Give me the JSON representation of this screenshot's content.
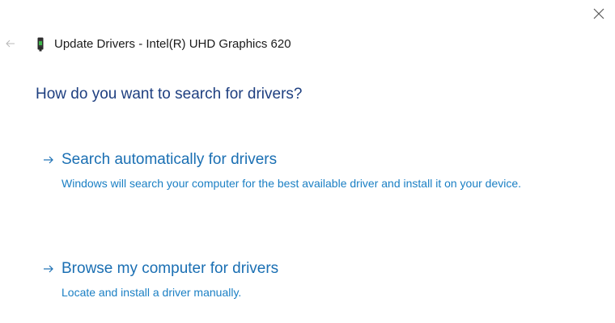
{
  "window": {
    "title": "Update Drivers - Intel(R) UHD Graphics 620",
    "icons": {
      "back": "back-arrow-icon",
      "device": "device-icon",
      "close": "close-icon"
    }
  },
  "main": {
    "heading": "How do you want to search for drivers?",
    "options": [
      {
        "title": "Search automatically for drivers",
        "description": "Windows will search your computer for the best available driver and install it on your device."
      },
      {
        "title": "Browse my computer for drivers",
        "description": "Locate and install a driver manually."
      }
    ]
  },
  "colors": {
    "heading": "#1e3f80",
    "link": "#1a6fb3",
    "link_desc": "#1a7fc4",
    "title_text": "#1a1a1a"
  }
}
